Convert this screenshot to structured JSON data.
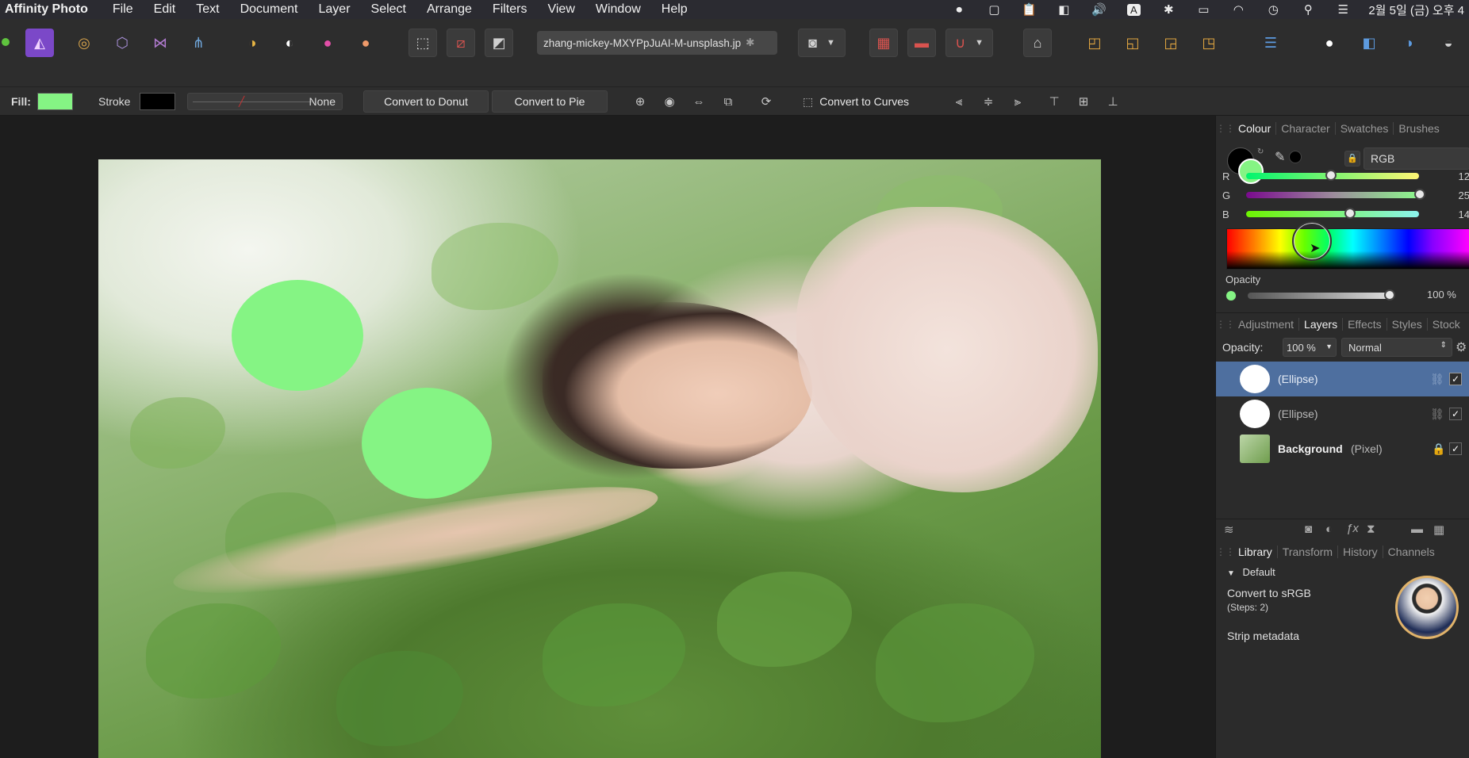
{
  "menubar": {
    "app_name": "Affinity Photo",
    "items": [
      "File",
      "Edit",
      "Text",
      "Document",
      "Layer",
      "Select",
      "Arrange",
      "Filters",
      "View",
      "Window",
      "Help"
    ],
    "status_letter": "A",
    "clock": "2월 5일 (금) 오후 4"
  },
  "toolbar": {
    "document_tab": "zhang-mickey-MXYPpJuAI-M-unsplash.jp",
    "document_modified_mark": "✱"
  },
  "context": {
    "fill_label": "Fill:",
    "fill_color": "#85f484",
    "stroke_label": "Stroke",
    "stroke_color": "#000000",
    "stroke_style": "None",
    "convert_donut": "Convert to Donut",
    "convert_pie": "Convert to Pie",
    "convert_curves": "Convert to Curves"
  },
  "canvas": {
    "circles": [
      {
        "name": "ellipse-1"
      },
      {
        "name": "ellipse-2"
      }
    ]
  },
  "colour_panel": {
    "tabs": [
      "Colour",
      "Character",
      "Swatches",
      "Brushes"
    ],
    "active_tab": "Colour",
    "model": "RGB",
    "r_label": "R",
    "g_label": "G",
    "b_label": "B",
    "r_value": "12",
    "g_value": "25",
    "b_value": "14",
    "opacity_label": "Opacity",
    "opacity_value": "100 %",
    "primary_color": "#85f484"
  },
  "layers_panel": {
    "tabs": [
      "Adjustment",
      "Layers",
      "Effects",
      "Styles",
      "Stock"
    ],
    "active_tab": "Layers",
    "opacity_label": "Opacity:",
    "opacity_value": "100 %",
    "blend_mode": "Normal",
    "layers": [
      {
        "name": "",
        "type": "(Ellipse)",
        "selected": true
      },
      {
        "name": "",
        "type": "(Ellipse)",
        "selected": false
      },
      {
        "name": "Background",
        "type": "(Pixel)",
        "selected": false
      }
    ]
  },
  "library_panel": {
    "tabs": [
      "Library",
      "Transform",
      "History",
      "Channels"
    ],
    "active_tab": "Library",
    "group": "Default",
    "macros": [
      {
        "title": "Convert to sRGB",
        "steps": "(Steps: 2)"
      },
      {
        "title": "Strip metadata",
        "steps": ""
      }
    ]
  }
}
